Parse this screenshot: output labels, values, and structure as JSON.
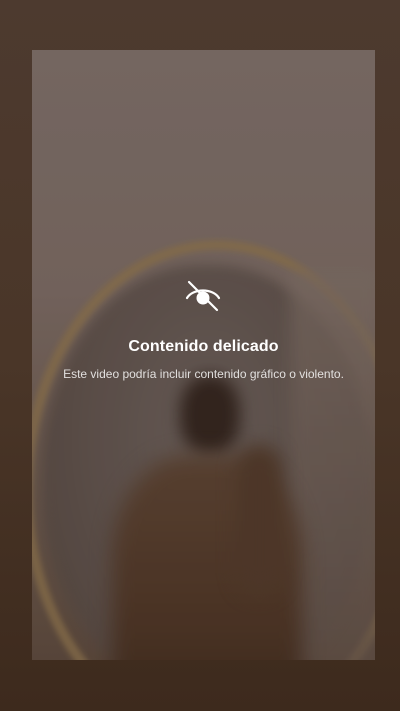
{
  "sensitive_content": {
    "icon": "eye-slash-icon",
    "title": "Contenido delicado",
    "description": "Este video podría incluir contenido gráfico o violento."
  }
}
